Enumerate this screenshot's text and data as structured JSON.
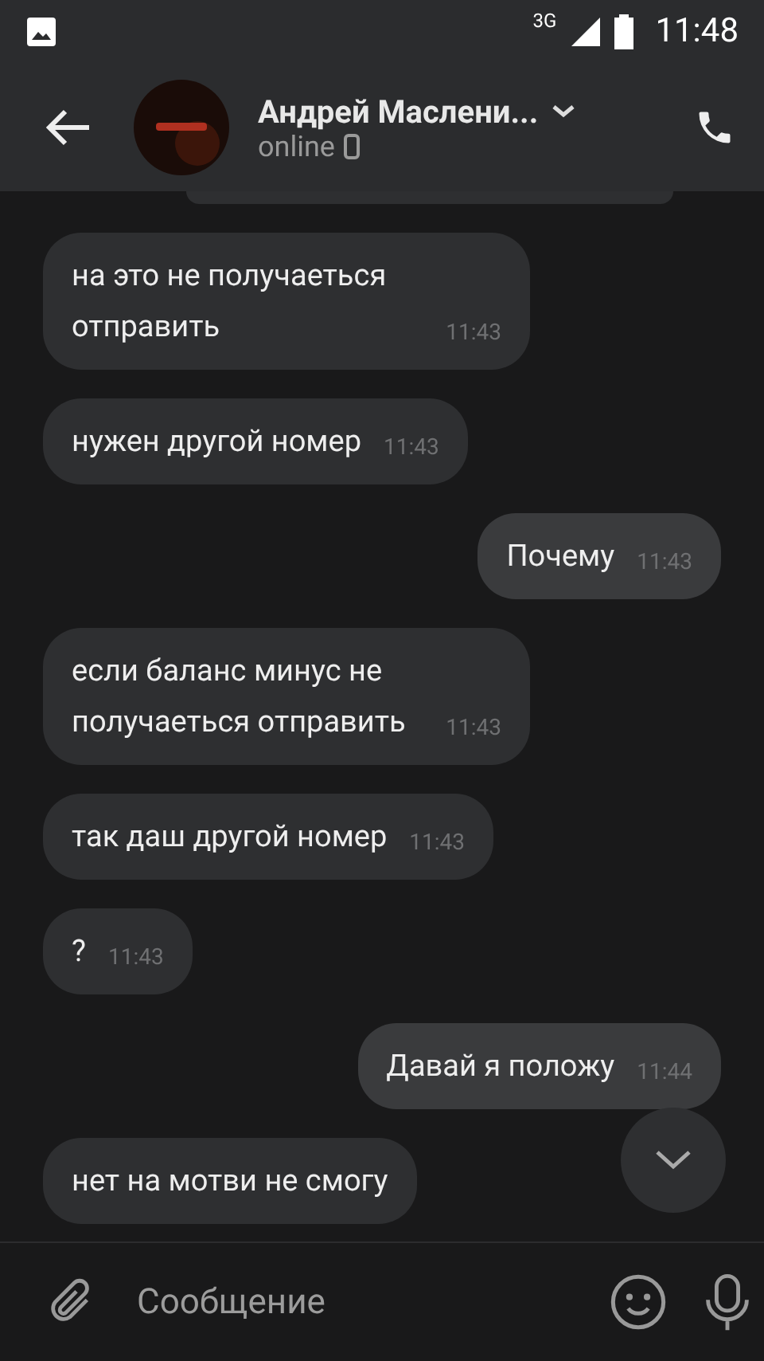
{
  "status_bar": {
    "network": "3G",
    "time": "11:48"
  },
  "header": {
    "name": "Андрей Маслени...",
    "status": "online"
  },
  "messages": [
    {
      "kind": "in",
      "text": "на это не получаеться отправить",
      "time": "11:43"
    },
    {
      "kind": "in",
      "text": "нужен другой номер",
      "time": "11:43"
    },
    {
      "kind": "out",
      "text": "Почему",
      "time": "11:43"
    },
    {
      "kind": "in",
      "text": "если баланс минус не получаеться отправить",
      "time": "11:43"
    },
    {
      "kind": "in",
      "text": "так даш другой номер",
      "time": "11:43"
    },
    {
      "kind": "in",
      "text": "?",
      "time": "11:43"
    },
    {
      "kind": "out",
      "text": "Давай я положу",
      "time": "11:44"
    },
    {
      "kind": "in",
      "text": "нет на мотви не смогу"
    }
  ],
  "composer": {
    "placeholder": "Сообщение"
  }
}
